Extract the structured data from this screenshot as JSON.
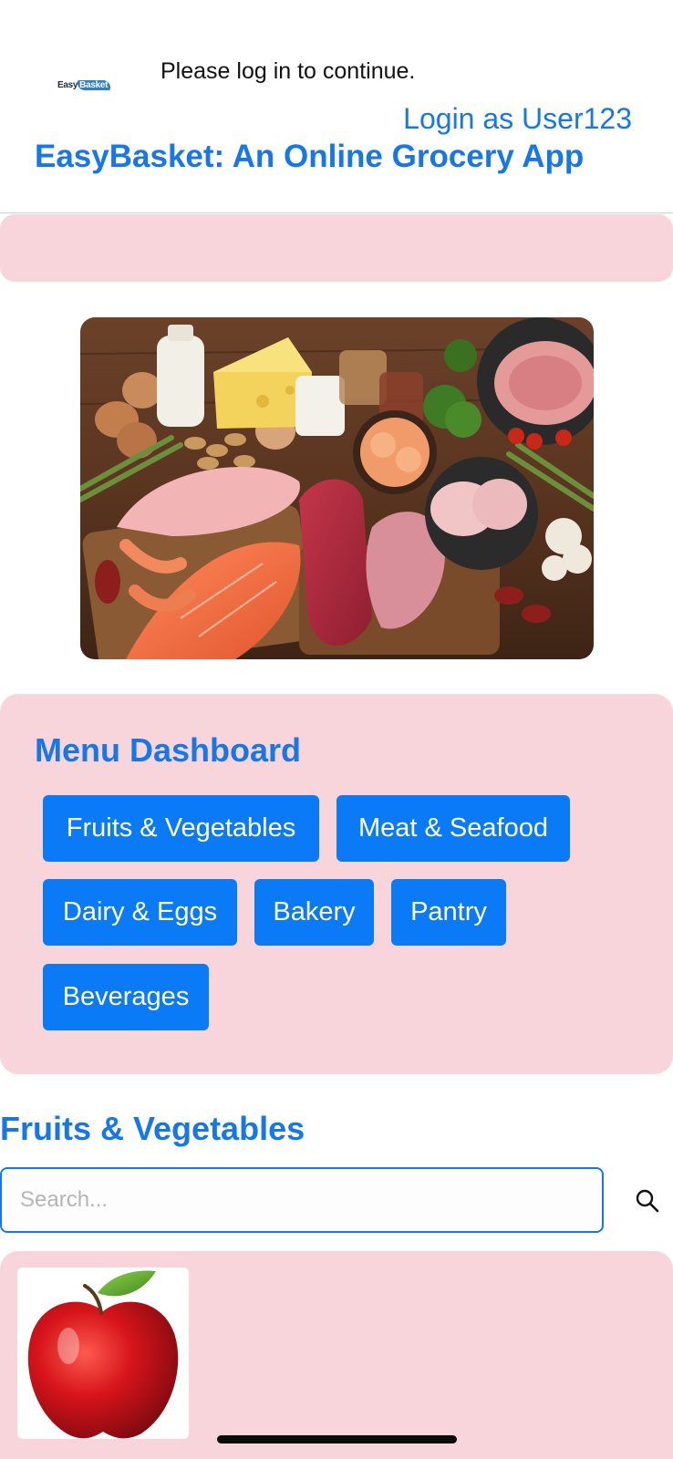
{
  "header": {
    "logo_part1": "Easy",
    "logo_part2": "Basket",
    "login_prompt": "Please log in to continue.",
    "login_link": "Login as User123",
    "app_title": "EasyBasket: An Online Grocery App"
  },
  "menu": {
    "title": "Menu Dashboard",
    "categories": [
      "Fruits & Vegetables",
      "Meat & Seafood",
      "Dairy & Eggs",
      "Bakery",
      "Pantry",
      "Beverages"
    ]
  },
  "section": {
    "title": "Fruits & Vegetables",
    "search_placeholder": "Search..."
  },
  "colors": {
    "accent": "#1877e8",
    "button": "#0b7af7",
    "panel": "#f7d5da"
  },
  "icons": {
    "search": "search-icon"
  }
}
